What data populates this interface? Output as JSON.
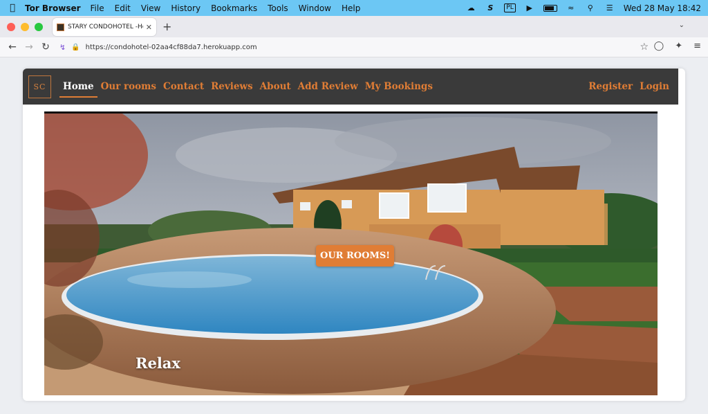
{
  "menubar": {
    "app_name": "Tor Browser",
    "items": [
      "File",
      "Edit",
      "View",
      "History",
      "Bookmarks",
      "Tools",
      "Window",
      "Help"
    ],
    "input_indicator": "PL",
    "datetime": "Wed 28 May  18:42"
  },
  "browser": {
    "tab_title": "STARY CONDOHOTEL -Home",
    "url": "https://condohotel-02aa4cf88da7.herokuapp.com"
  },
  "site": {
    "logo_text": "SC",
    "nav": [
      "Home",
      "Our rooms",
      "Contact",
      "Reviews",
      "About",
      "Add Review",
      "My Bookings"
    ],
    "nav_right": [
      "Register",
      "Login"
    ],
    "accent_color": "#e07d35",
    "navbar_color": "#3a3a3a"
  },
  "hero": {
    "button_label": "OUR ROOMS!",
    "caption": "Relax"
  }
}
